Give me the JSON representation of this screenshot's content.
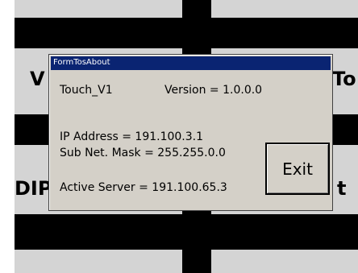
{
  "background": {
    "tile_labels": [
      "V",
      "To",
      "DIP",
      "t"
    ]
  },
  "dialog": {
    "title": "FormTosAbout",
    "app_name": "Touch_V1",
    "version": "Version = 1.0.0.0",
    "ip_address": "IP Address = 191.100.3.1",
    "subnet_mask": "Sub Net. Mask = 255.255.0.0",
    "active_server": "Active Server = 191.100.65.3",
    "exit_label": "Exit"
  },
  "colors": {
    "titlebar": "#0a2472",
    "dialog_face": "#d4d0c8",
    "panel": "#d4d4d4",
    "band": "#000000"
  }
}
